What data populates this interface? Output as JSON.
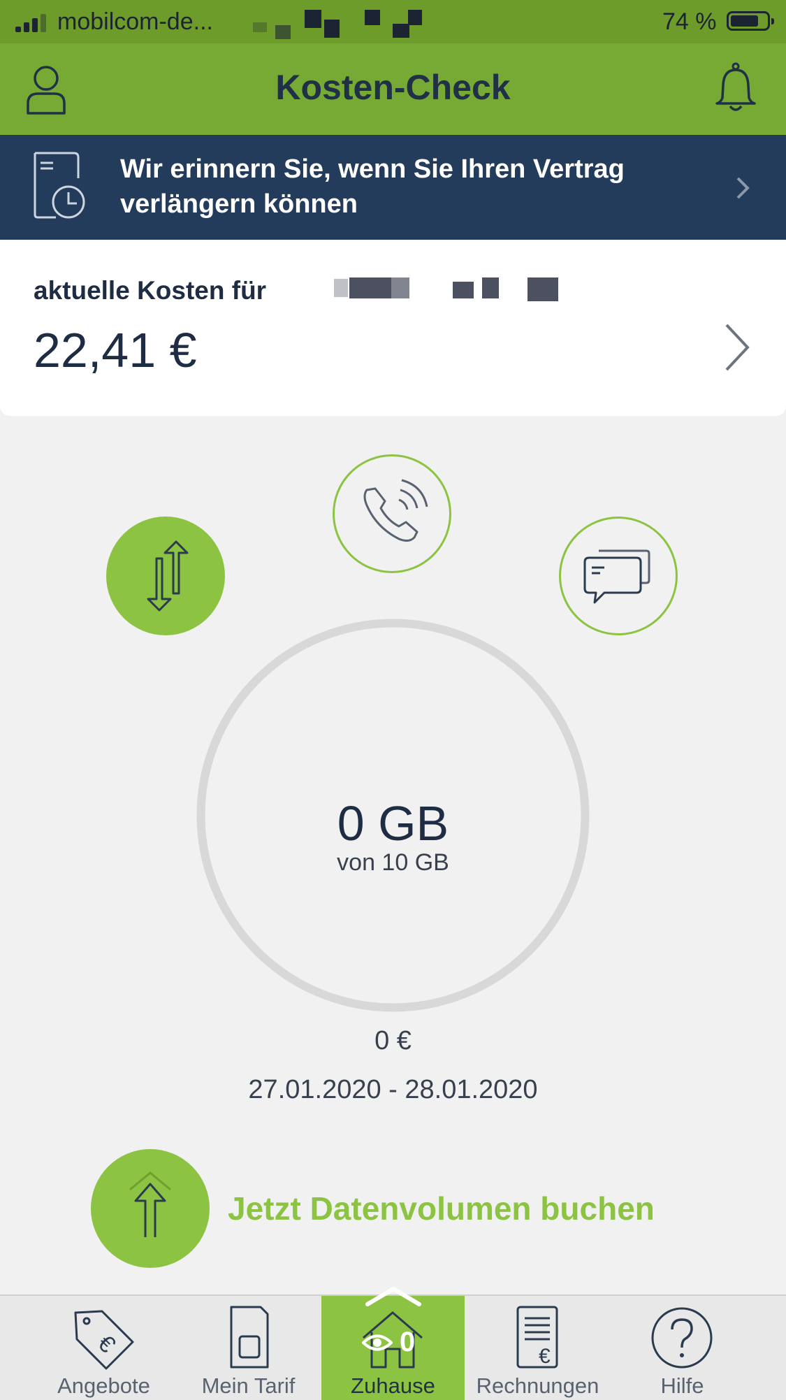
{
  "status_bar": {
    "carrier": "mobilcom-de...",
    "battery_percent": "74 %",
    "battery_level": 0.74
  },
  "header": {
    "title": "Kosten-Check",
    "left_icon": "profile-icon",
    "right_icon": "bell-icon"
  },
  "banner": {
    "text": "Wir erinnern Sie, wenn Sie Ihren Vertrag verlängern können",
    "icon": "contract-clock-icon"
  },
  "cost": {
    "label": "aktuelle Kosten für",
    "value": "22,41 €"
  },
  "usage": {
    "categories": [
      "data",
      "calls",
      "sms"
    ],
    "selected": "data",
    "amount": "0 GB",
    "of_total": "von 10 GB",
    "used_fraction": 0,
    "cost": "0 €",
    "period": "27.01.2020 - 28.01.2020"
  },
  "book_action": {
    "label": "Jetzt Datenvolumen buchen"
  },
  "tabs": [
    {
      "label": "Angebote",
      "icon": "price-tag-euro-icon"
    },
    {
      "label": "Mein Tarif",
      "icon": "sim-card-icon"
    },
    {
      "label": "Zuhause",
      "icon": "home-icon",
      "active": true
    },
    {
      "label": "Rechnungen",
      "icon": "invoice-euro-icon"
    },
    {
      "label": "Hilfe",
      "icon": "help-icon"
    }
  ],
  "overlay": {
    "view_count": "0"
  },
  "colors": {
    "accent_green": "#8dc342",
    "header_green": "#77a935",
    "banner_navy": "#243c5b",
    "text_dark": "#1f2d44"
  }
}
